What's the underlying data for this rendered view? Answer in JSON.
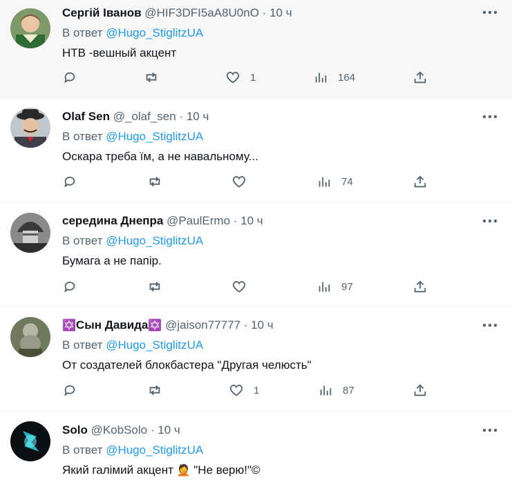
{
  "reply_prefix": "В ответ",
  "reply_handle": "@Hugo_StiglitzUA",
  "dot": "·",
  "tweets": [
    {
      "name": "Сергій Іванов",
      "handle": "@HIF3DFI5aA8U0nO",
      "time": "10 ч",
      "text": "НТВ -вешный акцент",
      "likes": "1",
      "views": "164"
    },
    {
      "name": "Olaf Sen",
      "handle": "@_olaf_sen",
      "time": "10 ч",
      "text": "Оскара треба їм, а не навальному...",
      "likes": "",
      "views": "74"
    },
    {
      "name": "середина Днепра",
      "handle": "@PaulErmo",
      "time": "10 ч",
      "text": "Бумага а не папір.",
      "likes": "",
      "views": "97"
    },
    {
      "name_pre": "✡️",
      "name": "Сын Давида",
      "name_post": "✡️",
      "handle": "@jaison77777",
      "time": "10 ч",
      "text": "От создателей блокбастера \"Другая челюсть\"",
      "likes": "1",
      "views": "87"
    },
    {
      "name": "Solo",
      "handle": "@KobSolo",
      "time": "10 ч",
      "text_pre": "Який галімий акцент ",
      "text_emoji": "🤦",
      "text_post": " \"Не верю!\"©"
    }
  ]
}
